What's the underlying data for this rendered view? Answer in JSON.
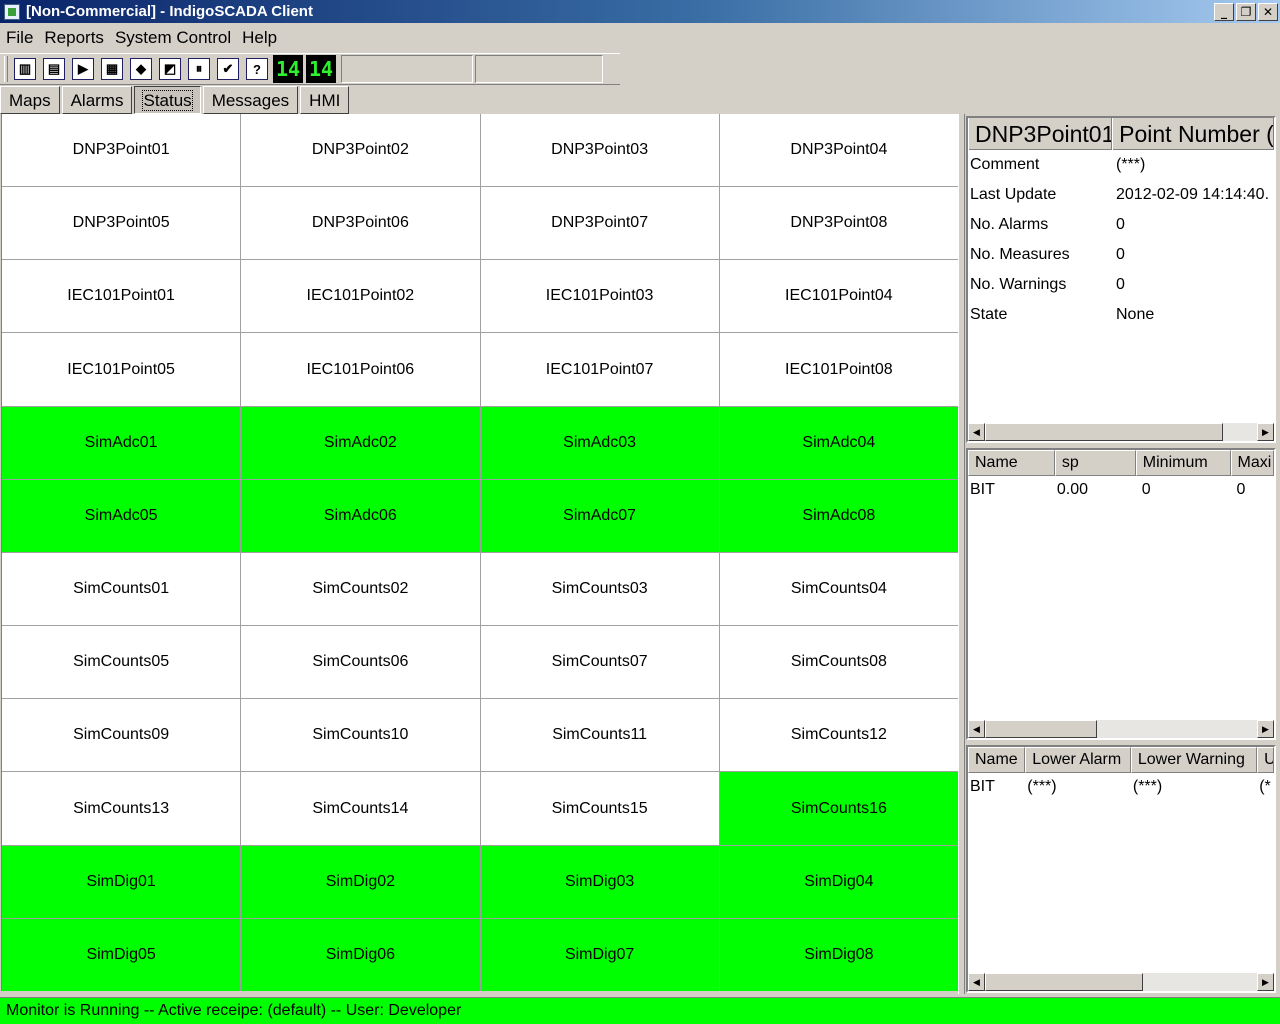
{
  "window": {
    "title": "[Non-Commercial] - IndigoSCADA Client",
    "min": "_",
    "max": "❐",
    "close": "✕"
  },
  "menu": [
    "File",
    "Reports",
    "System Control",
    "Help"
  ],
  "toolbar": {
    "icons": [
      "chart-icon",
      "report-icon",
      "play-icon",
      "config-icon",
      "stop-icon",
      "flag-icon",
      "pause-icon",
      "ack-check-icon",
      "help-icon"
    ],
    "glyphs": [
      "▥",
      "▤",
      "▶",
      "▦",
      "◆",
      "◩",
      "⏸",
      "✔",
      "?"
    ],
    "clock_left": "14",
    "clock_right": "14"
  },
  "tabs": [
    "Maps",
    "Alarms",
    "Status",
    "Messages",
    "HMI"
  ],
  "active_tab": "Status",
  "grid": [
    [
      {
        "t": "DNP3Point01",
        "g": false
      },
      {
        "t": "DNP3Point02",
        "g": false
      },
      {
        "t": "DNP3Point03",
        "g": false
      },
      {
        "t": "DNP3Point04",
        "g": false
      }
    ],
    [
      {
        "t": "DNP3Point05",
        "g": false
      },
      {
        "t": "DNP3Point06",
        "g": false
      },
      {
        "t": "DNP3Point07",
        "g": false
      },
      {
        "t": "DNP3Point08",
        "g": false
      }
    ],
    [
      {
        "t": "IEC101Point01",
        "g": false
      },
      {
        "t": "IEC101Point02",
        "g": false
      },
      {
        "t": "IEC101Point03",
        "g": false
      },
      {
        "t": "IEC101Point04",
        "g": false
      }
    ],
    [
      {
        "t": "IEC101Point05",
        "g": false
      },
      {
        "t": "IEC101Point06",
        "g": false
      },
      {
        "t": "IEC101Point07",
        "g": false
      },
      {
        "t": "IEC101Point08",
        "g": false
      }
    ],
    [
      {
        "t": "SimAdc01",
        "g": true
      },
      {
        "t": "SimAdc02",
        "g": true
      },
      {
        "t": "SimAdc03",
        "g": true
      },
      {
        "t": "SimAdc04",
        "g": true
      }
    ],
    [
      {
        "t": "SimAdc05",
        "g": true
      },
      {
        "t": "SimAdc06",
        "g": true
      },
      {
        "t": "SimAdc07",
        "g": true
      },
      {
        "t": "SimAdc08",
        "g": true
      }
    ],
    [
      {
        "t": "SimCounts01",
        "g": false
      },
      {
        "t": "SimCounts02",
        "g": false
      },
      {
        "t": "SimCounts03",
        "g": false
      },
      {
        "t": "SimCounts04",
        "g": false
      }
    ],
    [
      {
        "t": "SimCounts05",
        "g": false
      },
      {
        "t": "SimCounts06",
        "g": false
      },
      {
        "t": "SimCounts07",
        "g": false
      },
      {
        "t": "SimCounts08",
        "g": false
      }
    ],
    [
      {
        "t": "SimCounts09",
        "g": false
      },
      {
        "t": "SimCounts10",
        "g": false
      },
      {
        "t": "SimCounts11",
        "g": false
      },
      {
        "t": "SimCounts12",
        "g": false
      }
    ],
    [
      {
        "t": "SimCounts13",
        "g": false
      },
      {
        "t": "SimCounts14",
        "g": false
      },
      {
        "t": "SimCounts15",
        "g": false
      },
      {
        "t": "SimCounts16",
        "g": true
      }
    ],
    [
      {
        "t": "SimDig01",
        "g": true
      },
      {
        "t": "SimDig02",
        "g": true
      },
      {
        "t": "SimDig03",
        "g": true
      },
      {
        "t": "SimDig04",
        "g": true
      }
    ],
    [
      {
        "t": "SimDig05",
        "g": true
      },
      {
        "t": "SimDig06",
        "g": true
      },
      {
        "t": "SimDig07",
        "g": true
      },
      {
        "t": "SimDig08",
        "g": true
      }
    ]
  ],
  "colors": {
    "ok_green": "#00ff00",
    "cell_white": "#ffffff"
  },
  "details": {
    "header_name": "DNP3Point01",
    "header_col2": "Point Number (",
    "rows": [
      {
        "k": "Comment",
        "v": "(***)"
      },
      {
        "k": "Last Update",
        "v": "2012-02-09 14:14:40."
      },
      {
        "k": "No. Alarms",
        "v": "0"
      },
      {
        "k": "No. Measures",
        "v": "0"
      },
      {
        "k": "No. Warnings",
        "v": "0"
      },
      {
        "k": "State",
        "v": "None"
      }
    ]
  },
  "values_table": {
    "columns": [
      "Name",
      "sp",
      "Minimum",
      "Maxi"
    ],
    "rows": [
      [
        "BIT",
        "0.00",
        "0",
        "0"
      ]
    ]
  },
  "limits_table": {
    "columns": [
      "Name",
      "Lower Alarm",
      "Lower Warning",
      "U"
    ],
    "rows": [
      [
        "BIT",
        "(***)",
        "(***)",
        "(*"
      ]
    ]
  },
  "status": "Monitor is Running -- Active receipe: (default) -- User: Developer"
}
